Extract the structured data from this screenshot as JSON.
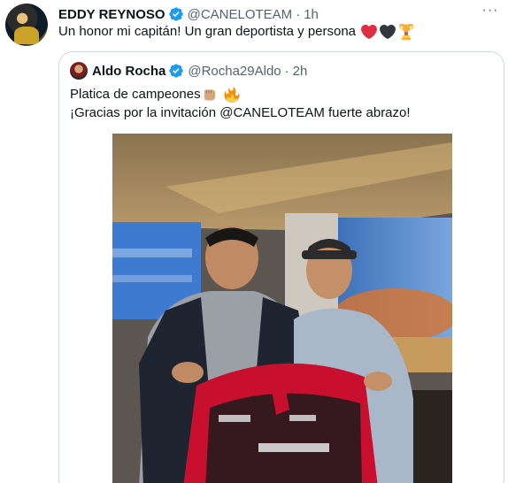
{
  "tweet": {
    "author_name": "EDDY REYNOSO",
    "author_handle": "@CANELOTEAM",
    "separator": "·",
    "time": "1h",
    "text": "Un honor mi capitán! Un gran deportista y persona",
    "emojis": [
      "red-heart-icon",
      "black-heart-icon",
      "trophy-icon"
    ],
    "more_label": "···"
  },
  "quote": {
    "author_name": "Aldo Rocha",
    "author_handle": "@Rocha29Aldo",
    "separator": "·",
    "time": "2h",
    "line1": "Platica de campeones",
    "line1_emojis": [
      "fist-bump-icon",
      "fire-icon"
    ],
    "line2": "¡Gracias por la invitación @CANELOTEAM fuerte abrazo!"
  },
  "colors": {
    "verified_blue": "#1d9bf0",
    "secondary_text": "#536471",
    "border": "#cfd9de",
    "jersey_red": "#c8102e"
  }
}
